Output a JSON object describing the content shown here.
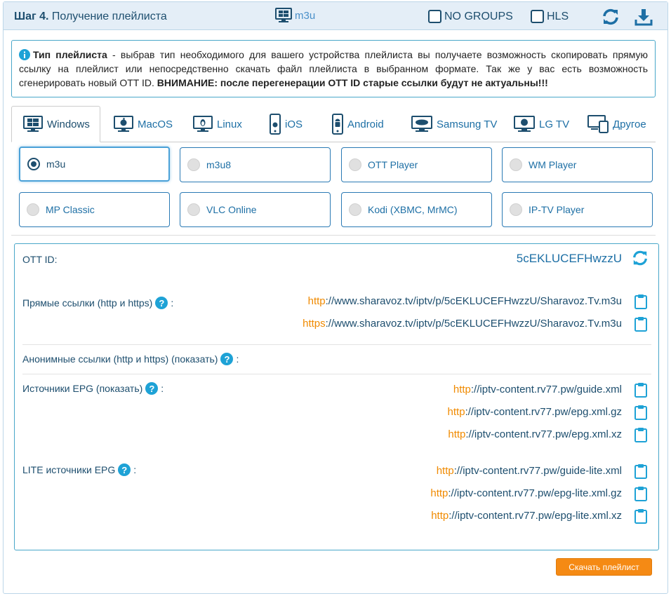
{
  "header": {
    "step_num": "Шаг 4.",
    "step_title": "Получение плейлиста",
    "format": "m3u",
    "no_groups": "NO GROUPS",
    "hls": "HLS"
  },
  "info": {
    "bold_lead": "Тип плейлиста",
    "text": " - выбрав тип необходимого для вашего устройства плейлиста вы получаете возможность скопировать прямую ссылку на плейлист или непосредственно скачать файл плейлиста в выбранном формате. Так же у вас есть возможность сгенерировать новый OTT ID. ",
    "warning": "ВНИМАНИЕ: после перегенерации OTT ID старые ссылки будут не актуальны!!!"
  },
  "tabs": [
    "Windows",
    "MacOS",
    "Linux",
    "iOS",
    "Android",
    "Samsung TV",
    "LG TV",
    "Другое"
  ],
  "players": [
    "m3u",
    "m3u8",
    "OTT Player",
    "WM Player",
    "MP Classic",
    "VLC Online",
    "Kodi (XBMC, MrMC)",
    "IP-TV Player"
  ],
  "ott": {
    "label": "OTT ID:",
    "value": "5cEKLUCEFHwzzU"
  },
  "direct": {
    "label": "Прямые ссылки (http и https)",
    "colon": ":",
    "links": [
      {
        "proto": "http",
        "rest": "://www.sharavoz.tv/iptv/p/5cEKLUCEFHwzzU/Sharavoz.Tv.m3u"
      },
      {
        "proto": "https",
        "rest": "://www.sharavoz.tv/iptv/p/5cEKLUCEFHwzzU/Sharavoz.Tv.m3u"
      }
    ]
  },
  "anon": {
    "label": "Анонимные ссылки (http и https) (показать)",
    "colon": ":"
  },
  "epg": {
    "label": "Источники EPG (показать)",
    "colon": ":",
    "links": [
      {
        "proto": "http",
        "rest": "://iptv-content.rv77.pw/guide.xml"
      },
      {
        "proto": "http",
        "rest": "://iptv-content.rv77.pw/epg.xml.gz"
      },
      {
        "proto": "http",
        "rest": "://iptv-content.rv77.pw/epg.xml.xz"
      }
    ]
  },
  "lite": {
    "label": "LITE источники EPG",
    "colon": ":",
    "links": [
      {
        "proto": "http",
        "rest": "://iptv-content.rv77.pw/guide-lite.xml"
      },
      {
        "proto": "http",
        "rest": "://iptv-content.rv77.pw/epg-lite.xml.gz"
      },
      {
        "proto": "http",
        "rest": "://iptv-content.rv77.pw/epg-lite.xml.xz"
      }
    ]
  },
  "download_button": "Скачать плейлист",
  "colors": {
    "accent": "#1d6fa5",
    "dark": "#1d4e6e",
    "proto": "#f08a00",
    "button": "#f58a14",
    "help": "#1ea2d6"
  }
}
